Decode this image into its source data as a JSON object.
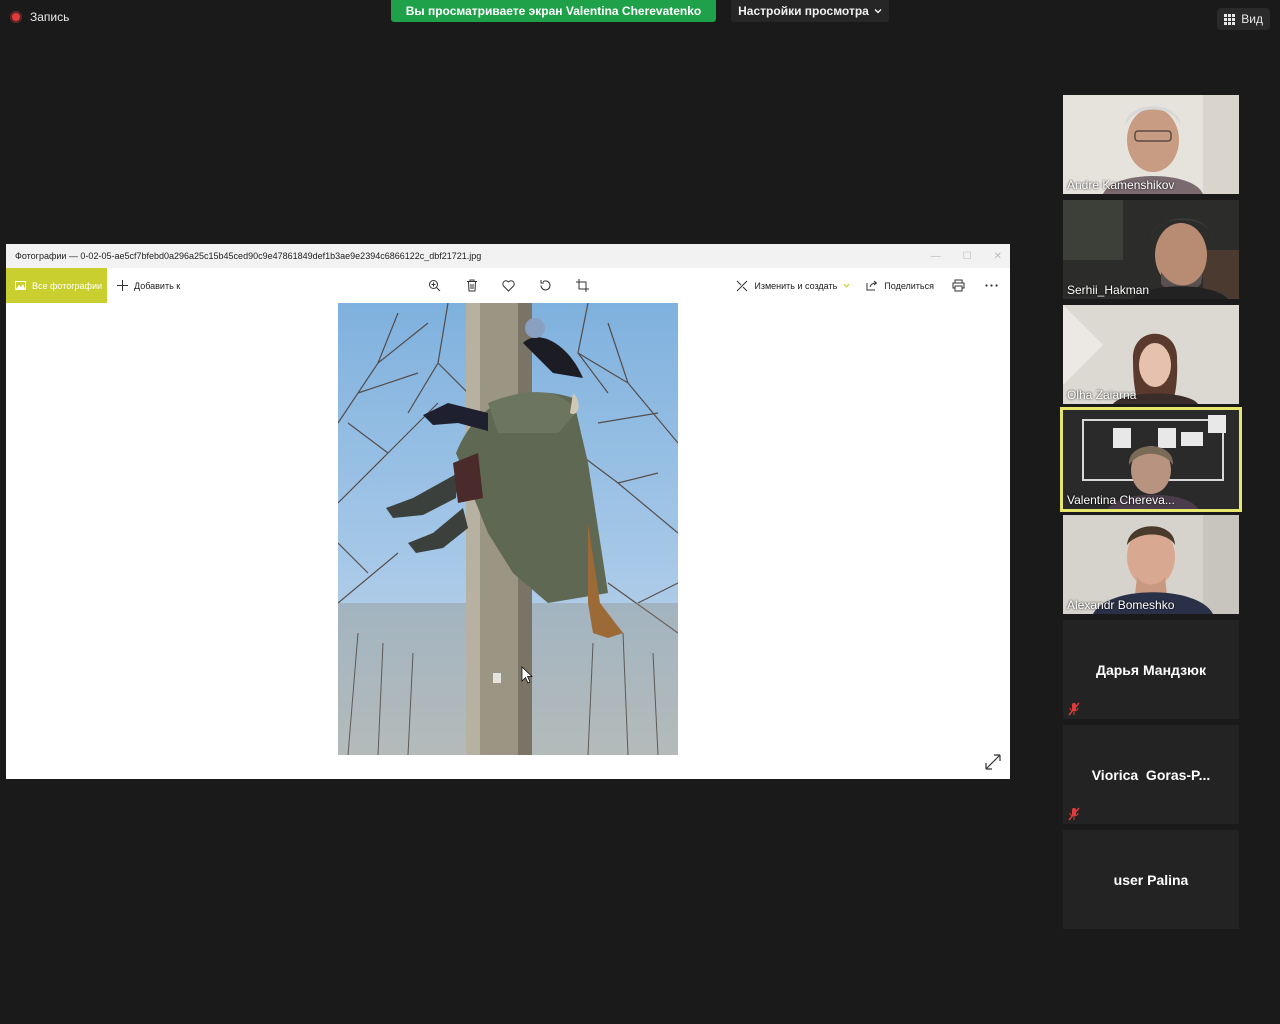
{
  "topbar": {
    "record_label": "Запись",
    "share_banner": "Вы просматриваете экран Valentina Cherevatenko",
    "view_settings_label": "Настройки просмотра",
    "view_label": "Вид"
  },
  "photos_window": {
    "title": "Фотографии — 0-02-05-ae5cf7bfebd0a296a25c15b45ced90c9e47861849def1b3ae9e2394c6866122c_dbf21721.jpg",
    "all_photos_label": "Все фотографии",
    "add_to_label": "Добавить к",
    "edit_create_label": "Изменить и создать",
    "share_label": "Поделиться",
    "accent_color": "#c9cf2e"
  },
  "participants": [
    {
      "name": "Andre Kamenshikov",
      "video": true
    },
    {
      "name": "Serhii_Hakman",
      "video": true
    },
    {
      "name": "Olha Zaiarna",
      "video": true
    },
    {
      "name": "Valentina Chereva...",
      "video": true,
      "active": true
    },
    {
      "name": "Alexandr Bomeshko",
      "video": true
    },
    {
      "name": "Дарья Мандзюк",
      "video": false,
      "muted": true
    },
    {
      "name": "Viorica  Goras-P...",
      "video": false,
      "muted": true
    },
    {
      "name": "user Palina",
      "video": false,
      "muted": false
    }
  ],
  "colors": {
    "banner_green": "#1fa14a",
    "active_speaker": "#e6e66d",
    "record_red": "#e23b3b"
  }
}
